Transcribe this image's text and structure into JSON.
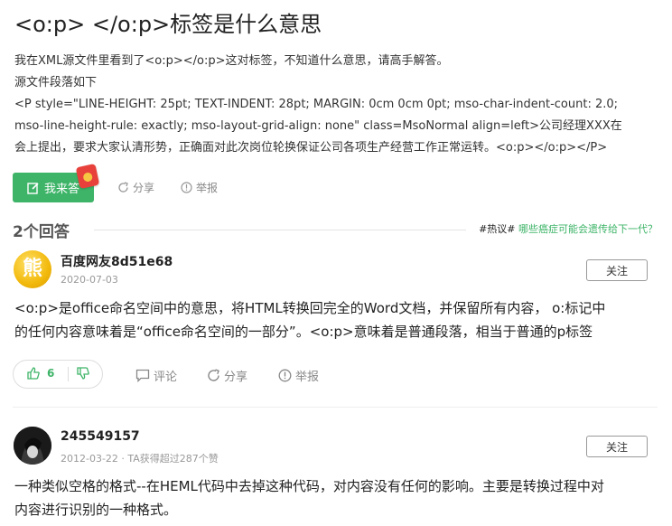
{
  "question": {
    "title": "<o:p> </o:p>标签是什么意思",
    "desc_lines": [
      "我在XML源文件里看到了<o:p></o:p>这对标签，不知道什么意思，请高手解答。",
      "源文件段落如下",
      "<P style=\"LINE-HEIGHT: 25pt; TEXT-INDENT: 28pt; MARGIN: 0cm 0cm 0pt; mso-char-indent-count: 2.0;",
      "mso-line-height-rule: exactly; mso-layout-grid-align: none\" class=MsoNormal align=left>公司经理XXX在",
      "会上提出，要求大家认清形势，正确面对此次岗位轮换保证公司各项生产经营工作正常运转。<o:p></o:p></P>"
    ],
    "answer_button": "我来答",
    "share": "分享",
    "report": "举报"
  },
  "answers_header": {
    "count": "2个回答",
    "hot_tag": "#热议#",
    "hot_link": "哪些癌症可能会遗传给下一代？"
  },
  "answers": [
    {
      "user": "百度网友8d51e68",
      "meta": "2020-07-03",
      "follow": "关注",
      "lines": [
        "<o:p>是office命名空间中的意思，将HTML转换回完全的Word文档，并保留所有内容， o:标记中",
        "的任何内容意味着是“office命名空间的一部分”。<o:p>意味着是普通段落，相当于普通的p标签"
      ],
      "likes": "6",
      "comment": "评论",
      "share": "分享",
      "report": "举报",
      "avatar_glyph": "熊"
    },
    {
      "user": "245549157",
      "meta": "2012-03-22 · TA获得超过287个赞",
      "follow": "关注",
      "lines": [
        "一种类似空格的格式--在HEML代码中去掉这种代码，对内容没有任何的影响。主要是转换过程中对",
        "内容进行识别的一种格式。"
      ]
    }
  ],
  "colors": {
    "accent": "#3eb468",
    "muted": "#888888",
    "hot_red": "#e8413b"
  }
}
